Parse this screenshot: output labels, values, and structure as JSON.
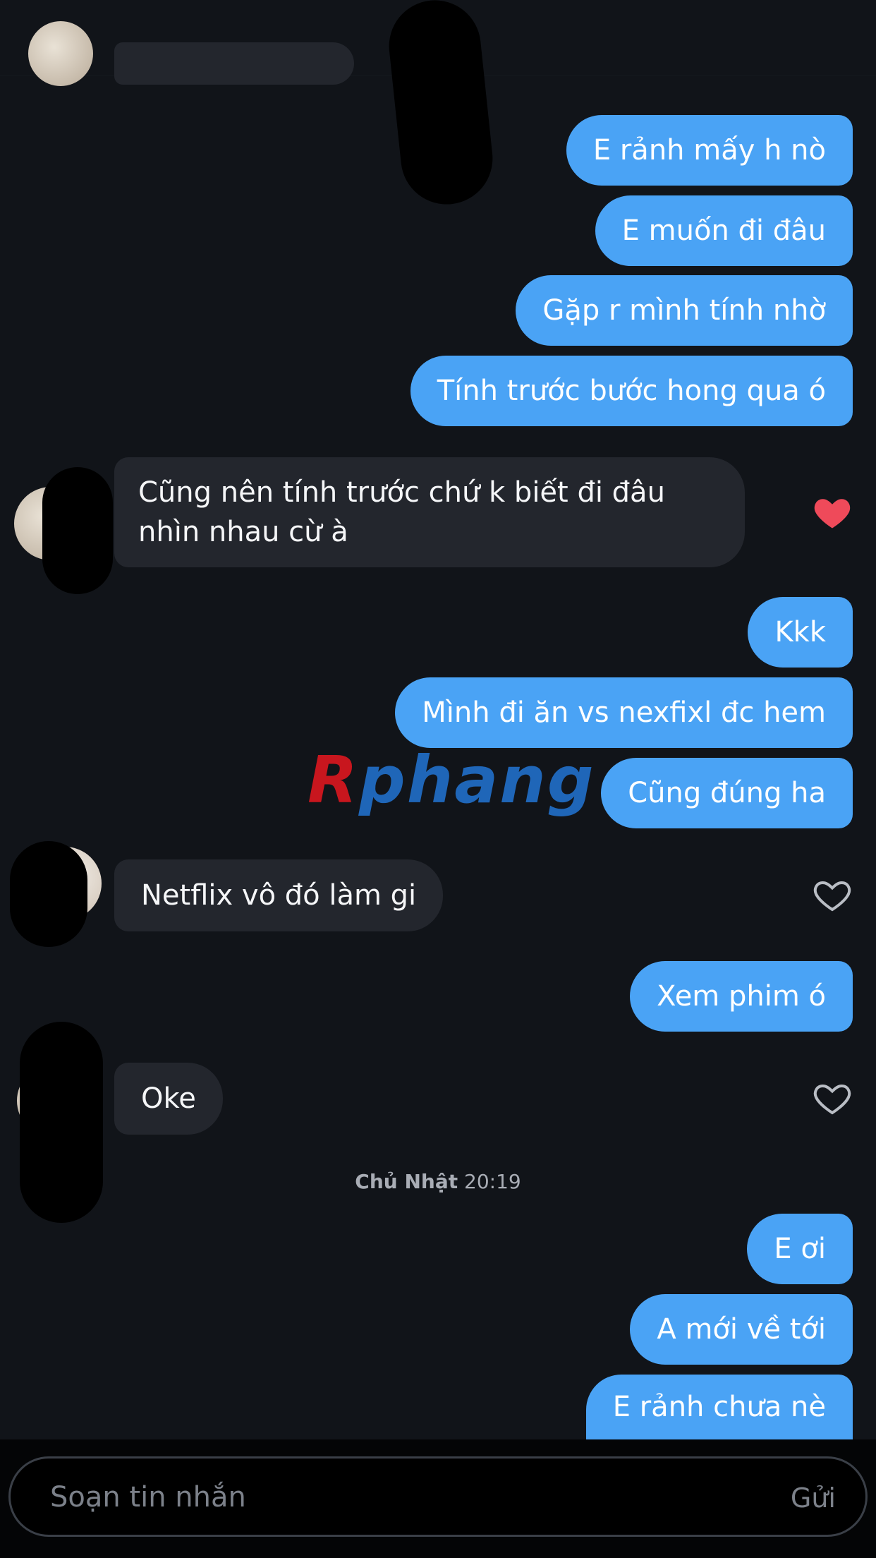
{
  "messages": {
    "m1": "E rảnh mấy h nò",
    "m2": "E muốn đi đâu",
    "m3": "Gặp r mình tính nhờ",
    "m4": "Tính trước bước hong qua ó",
    "m5": "Cũng nên tính trước chứ k biết đi đâu nhìn nhau cừ à",
    "m6": "Kkk",
    "m7": "Mình đi ăn vs nexfixl đc hem",
    "m8": "Cũng đúng ha",
    "m9": "Netflix vô đó làm gi",
    "m10": "Xem phim ó",
    "m11": "Oke",
    "m12": "E ơi",
    "m13": "A mới về tới",
    "m14": "E rảnh chưa nè"
  },
  "likes": {
    "m5": true,
    "m9": false,
    "m11": false
  },
  "timestamp": {
    "day": "Chủ Nhật",
    "time": "20:19"
  },
  "watermark": {
    "first": "R",
    "rest": "phang"
  },
  "composer": {
    "placeholder": "Soạn tin nhắn",
    "send_label": "Gửi"
  },
  "colors": {
    "background": "#111419",
    "outgoing_bubble": "#4aa3f5",
    "incoming_bubble": "#23262d",
    "liked_heart": "#ef4a5a"
  }
}
